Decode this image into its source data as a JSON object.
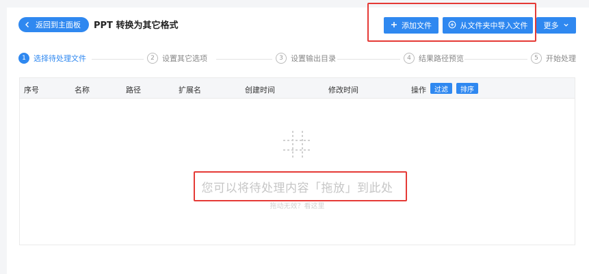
{
  "header": {
    "back_label": "返回到主面板",
    "title": "PPT 转换为其它格式",
    "add_file_label": "添加文件",
    "import_folder_label": "从文件夹中导入文件",
    "more_label": "更多"
  },
  "steps": [
    {
      "num": "1",
      "label": "选择待处理文件",
      "active": true
    },
    {
      "num": "2",
      "label": "设置其它选项",
      "active": false
    },
    {
      "num": "3",
      "label": "设置输出目录",
      "active": false
    },
    {
      "num": "4",
      "label": "结果路径预览",
      "active": false
    },
    {
      "num": "5",
      "label": "开始处理",
      "active": false
    }
  ],
  "table": {
    "columns": [
      "序号",
      "名称",
      "路径",
      "扩展名",
      "创建时间",
      "修改时间",
      "操作"
    ],
    "filter_label": "过滤",
    "sort_label": "排序",
    "empty_text": "您可以将待处理内容「拖放」到此处",
    "empty_hint": "拖动无效？看这里"
  },
  "colors": {
    "accent": "#2f88f0",
    "highlight": "#e53935"
  },
  "icons": {
    "back": "chevron-left-icon",
    "add": "plus-icon",
    "import": "circle-plus-icon",
    "more": "chevron-down-icon",
    "drop": "drop-zone-icon"
  }
}
